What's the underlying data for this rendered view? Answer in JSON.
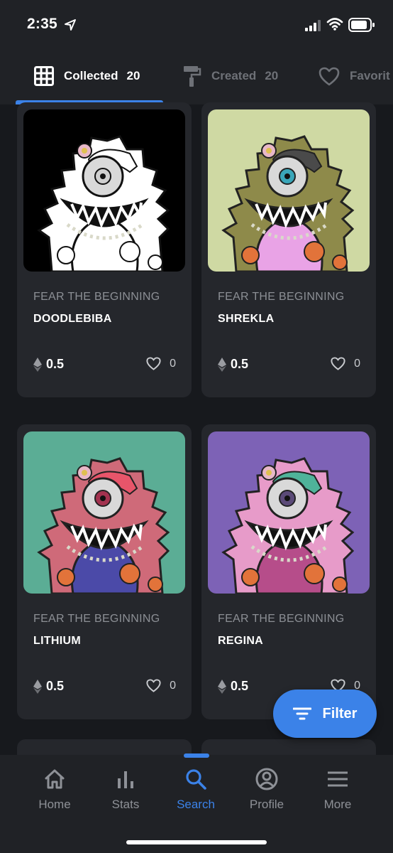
{
  "status_bar": {
    "time": "2:35"
  },
  "tabs": [
    {
      "label": "Collected",
      "count": "20",
      "icon": "grid-icon"
    },
    {
      "label": "Created",
      "count": "20",
      "icon": "paint-roller-icon"
    },
    {
      "label": "Favorit",
      "icon": "heart-icon"
    }
  ],
  "cards": [
    {
      "collection": "FEAR THE BEGINNING",
      "name": "DOODLEBIBA",
      "price": "0.5",
      "likes": "0",
      "bg": "#000000",
      "body": "#ffffff",
      "hair": "#ffffff",
      "pattern": "#ffffff",
      "iris": "#cfcfcf"
    },
    {
      "collection": "FEAR THE BEGINNING",
      "name": "SHREKLA",
      "price": "0.5",
      "likes": "0",
      "bg": "#cfd9a3",
      "body": "#8e8a4a",
      "hair": "#4a4a4a",
      "pattern": "#e9a3e6",
      "iris": "#3aa6b9"
    },
    {
      "collection": "FEAR THE BEGINNING",
      "name": "LITHIUM",
      "price": "0.5",
      "likes": "0",
      "bg": "#5bad95",
      "body": "#cf6a79",
      "hair": "#e8556a",
      "pattern": "#4b4aa8",
      "iris": "#a2324f"
    },
    {
      "collection": "FEAR THE BEGINNING",
      "name": "REGINA",
      "price": "0.5",
      "likes": "0",
      "bg": "#7d62b6",
      "body": "#e79bc9",
      "hair": "#4fb39a",
      "pattern": "#b64d8a",
      "iris": "#5b4a78"
    }
  ],
  "filter_button": {
    "label": "Filter"
  },
  "bottom_nav": [
    {
      "label": "Home",
      "icon": "home-icon"
    },
    {
      "label": "Stats",
      "icon": "stats-icon"
    },
    {
      "label": "Search",
      "icon": "search-icon"
    },
    {
      "label": "Profile",
      "icon": "profile-icon"
    },
    {
      "label": "More",
      "icon": "menu-icon"
    }
  ],
  "colors": {
    "accent": "#3b82e8",
    "background": "#17191d",
    "card": "#25272c"
  }
}
